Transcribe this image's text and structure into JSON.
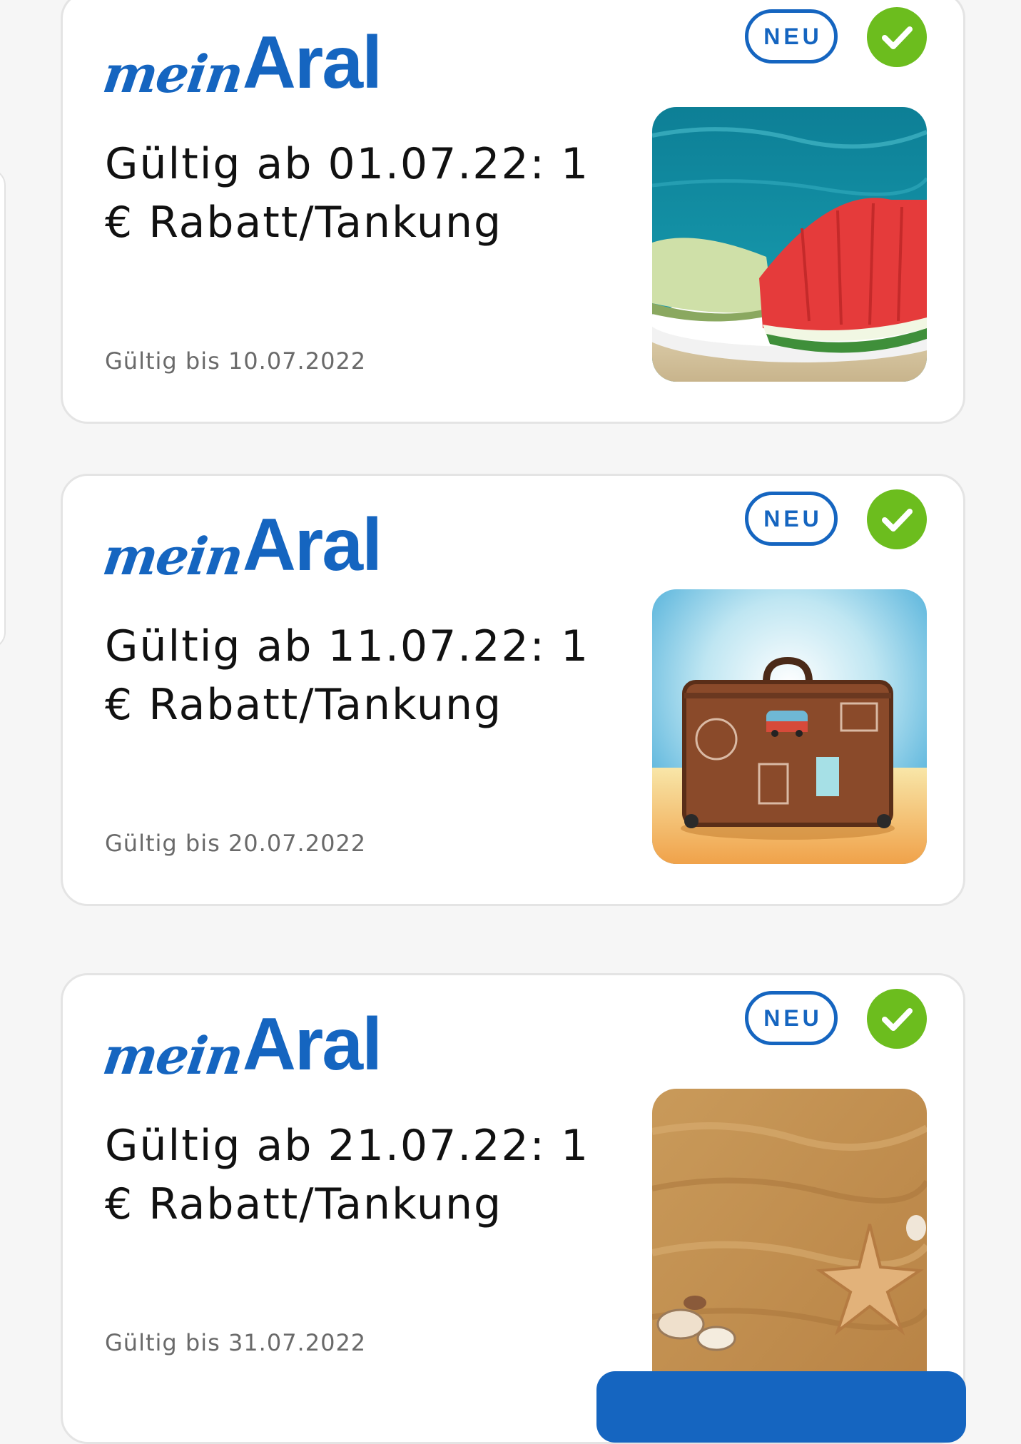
{
  "offers": [
    {
      "logo": {
        "part1": "mein",
        "part2": "Aral"
      },
      "badge": "NEU",
      "status_icon": "check-icon",
      "title": "Gültig ab 01.07.22: 1 € Rabatt/Tankung",
      "valid_until": "Gültig bis 10.07.2022",
      "image": "melon-watermelon-pool"
    },
    {
      "logo": {
        "part1": "mein",
        "part2": "Aral"
      },
      "badge": "NEU",
      "status_icon": "check-icon",
      "title": "Gültig ab 11.07.22: 1 € Rabatt/Tankung",
      "valid_until": "Gültig bis 20.07.2022",
      "image": "vintage-suitcase-beach"
    },
    {
      "logo": {
        "part1": "mein",
        "part2": "Aral"
      },
      "badge": "NEU",
      "status_icon": "check-icon",
      "title": "Gültig ab 21.07.22: 1 € Rabatt/Tankung",
      "valid_until": "Gültig bis 31.07.2022",
      "image": "sand-starfish-shells"
    }
  ],
  "colors": {
    "brand": "#1565c0",
    "check": "#6cbd1e",
    "text": "#111111",
    "muted": "#6a6a6a"
  }
}
